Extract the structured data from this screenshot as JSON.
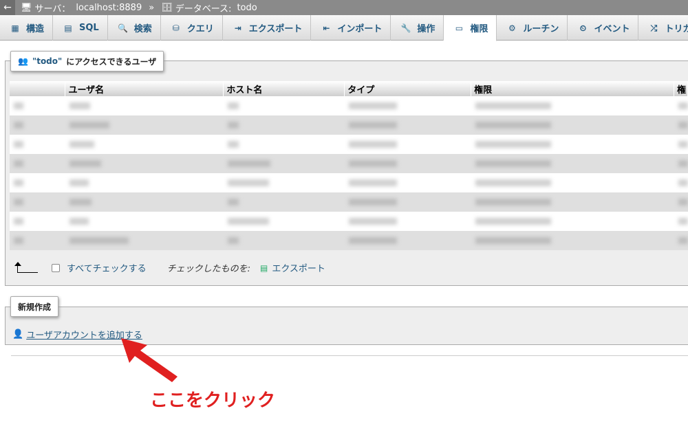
{
  "topbar": {
    "back": "←",
    "server_label": "サーバ：",
    "server": "localhost:8889",
    "sep": "»",
    "db_label": "データベース:",
    "db": "todo"
  },
  "tabs": [
    {
      "label": "構造",
      "icon": "structure-icon"
    },
    {
      "label": "SQL",
      "icon": "sql-icon"
    },
    {
      "label": "検索",
      "icon": "search-icon"
    },
    {
      "label": "クエリ",
      "icon": "query-icon"
    },
    {
      "label": "エクスポート",
      "icon": "export-icon"
    },
    {
      "label": "インポート",
      "icon": "import-icon"
    },
    {
      "label": "操作",
      "icon": "wrench-icon"
    },
    {
      "label": "権限",
      "icon": "privileges-icon",
      "active": true
    },
    {
      "label": "ルーチン",
      "icon": "routines-icon"
    },
    {
      "label": "イベント",
      "icon": "clock-icon"
    },
    {
      "label": "トリガ",
      "icon": "trigger-icon"
    }
  ],
  "users_panel": {
    "legend_quoted": "\"todo\"",
    "legend_rest": "にアクセスできるユーザ"
  },
  "table": {
    "headers": [
      "",
      "ユーザ名",
      "ホスト名",
      "タイプ",
      "権限",
      "権"
    ]
  },
  "bulk": {
    "check_all": "すべてチェックする",
    "with_selected": "チェックしたものを:",
    "export": "エクスポート"
  },
  "create_panel": {
    "legend": "新規作成",
    "add_user": "ユーザアカウントを追加する"
  },
  "annotation": {
    "callout": "ここをクリック",
    "color": "#e02020"
  }
}
